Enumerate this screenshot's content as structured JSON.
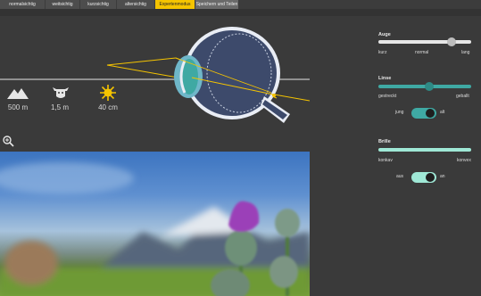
{
  "tabs": [
    {
      "label": "normalsichtig",
      "active": false
    },
    {
      "label": "weitsichtig",
      "active": false
    },
    {
      "label": "kurzsichtig",
      "active": false
    },
    {
      "label": "altersichtig",
      "active": false
    },
    {
      "label": "Expertenmodus",
      "active": true
    },
    {
      "label": "Speichern und Teilen",
      "active": false
    }
  ],
  "distances": [
    {
      "icon": "mountain-icon",
      "label": "500 m"
    },
    {
      "icon": "cow-icon",
      "label": "1,5 m"
    },
    {
      "icon": "sun-flower-icon",
      "label": "40 cm"
    }
  ],
  "controls": {
    "auge": {
      "title": "Auge",
      "min_label": "kurz",
      "mid_label": "normal",
      "max_label": "lang",
      "value": 0.82
    },
    "linse": {
      "title": "Linse",
      "min_label": "gestreckt",
      "max_label": "geballt",
      "value": 0.55,
      "toggle_left": "jung",
      "toggle_right": "alt",
      "toggle_on": true
    },
    "brille": {
      "title": "Brille",
      "min_label": "konkav",
      "max_label": "konvex",
      "toggle_left": "aus",
      "toggle_right": "an",
      "toggle_on": true
    }
  },
  "colors": {
    "accent": "#f5c400",
    "teal": "#3fa9a3",
    "mint": "#9fe8d6",
    "eye_body": "#3d4a6b"
  }
}
